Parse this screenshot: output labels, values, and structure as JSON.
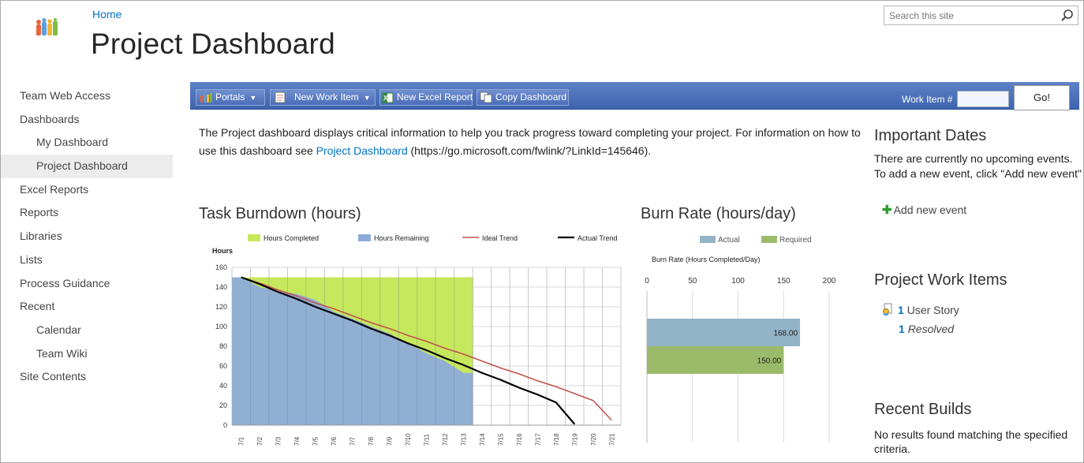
{
  "header": {
    "breadcrumb": "Home",
    "title": "Project Dashboard",
    "search_placeholder": "Search this site"
  },
  "nav": {
    "items": [
      {
        "label": "Team Web Access",
        "level": 0,
        "selected": false
      },
      {
        "label": "Dashboards",
        "level": 0,
        "selected": false
      },
      {
        "label": "My Dashboard",
        "level": 1,
        "selected": false
      },
      {
        "label": "Project Dashboard",
        "level": 1,
        "selected": true
      },
      {
        "label": "Excel Reports",
        "level": 0,
        "selected": false
      },
      {
        "label": "Reports",
        "level": 0,
        "selected": false
      },
      {
        "label": "Libraries",
        "level": 0,
        "selected": false
      },
      {
        "label": "Lists",
        "level": 0,
        "selected": false
      },
      {
        "label": "Process Guidance",
        "level": 0,
        "selected": false
      },
      {
        "label": "Recent",
        "level": 0,
        "selected": false
      },
      {
        "label": "Calendar",
        "level": 1,
        "selected": false
      },
      {
        "label": "Team Wiki",
        "level": 1,
        "selected": false
      },
      {
        "label": "Site Contents",
        "level": 0,
        "selected": false
      }
    ]
  },
  "toolbar": {
    "portals": "Portals",
    "new_work_item": "New Work Item",
    "new_excel_report": "New Excel Report",
    "copy_dashboard": "Copy Dashboard",
    "work_item_label": "Work Item #",
    "go": "Go!"
  },
  "description": {
    "before": "The Project dashboard displays critical information to help you track progress toward completing your project. For information on how to use this dashboard see ",
    "link": "Project Dashboard",
    "after": " (https://go.microsoft.com/fwlink/?LinkId=145646)."
  },
  "burndown": {
    "title": "Task Burndown (hours)"
  },
  "burnrate": {
    "title": "Burn Rate (hours/day)"
  },
  "important_dates": {
    "title": "Important Dates",
    "line1": "There are currently no upcoming events.",
    "line2": "To add a new event, click \"Add new event\"",
    "add_event": "Add new event"
  },
  "work_items": {
    "title": "Project Work Items",
    "count": "1",
    "type": "User Story",
    "resolved_count": "1",
    "resolved_label": "Resolved"
  },
  "recent_builds": {
    "title": "Recent Builds",
    "text": "No results found matching the specified criteria."
  },
  "colors": {
    "hours_completed": "#c5e85c",
    "hours_remaining": "#8eabd9",
    "ideal_trend": "#c0504d",
    "actual_trend": "#000000",
    "actual_bar": "#93b3c6",
    "required_bar": "#9bbb6a",
    "toolbar": "#4a6fb8",
    "link": "#0072c6"
  },
  "chart_data": [
    {
      "type": "area",
      "y_axis_title": "Hours",
      "ylim": [
        0,
        160
      ],
      "y_ticks": [
        0,
        20,
        40,
        60,
        80,
        100,
        120,
        140,
        160
      ],
      "x": [
        "7/1",
        "7/2",
        "7/3",
        "7/4",
        "7/5",
        "7/6",
        "7/7",
        "7/8",
        "7/9",
        "7/10",
        "7/11",
        "7/12",
        "7/13",
        "7/14",
        "7/15",
        "7/16",
        "7/17",
        "7/18",
        "7/19",
        "7/20",
        "7/21"
      ],
      "grid": true,
      "legend_position": "top",
      "series": [
        {
          "name": "Hours Completed",
          "kind": "area",
          "values": [
            150,
            150,
            150,
            150,
            150,
            150,
            150,
            150,
            150,
            150,
            150,
            150,
            150,
            null,
            null,
            null,
            null,
            null,
            null,
            null,
            null
          ]
        },
        {
          "name": "Hours Remaining",
          "kind": "area",
          "values": [
            150,
            140,
            136,
            133,
            127,
            115,
            108,
            100,
            93,
            83,
            73,
            65,
            53,
            null,
            null,
            null,
            null,
            null,
            null,
            null,
            null
          ]
        },
        {
          "name": "Ideal Trend",
          "kind": "line",
          "values": [
            150,
            144,
            137,
            131,
            124,
            118,
            111,
            104,
            98,
            91,
            85,
            78,
            72,
            65,
            58,
            52,
            45,
            39,
            32,
            25,
            5
          ]
        },
        {
          "name": "Actual Trend",
          "kind": "line",
          "values": [
            150,
            143,
            135,
            128,
            120,
            113,
            106,
            98,
            91,
            83,
            76,
            68,
            61,
            53,
            46,
            38,
            31,
            23,
            1,
            null,
            null
          ]
        }
      ]
    },
    {
      "type": "bar",
      "orientation": "horizontal",
      "title": "Burn Rate (Hours Completed/Day)",
      "xlim": [
        0,
        200
      ],
      "x_ticks": [
        0,
        50,
        100,
        150,
        200
      ],
      "legend_position": "top",
      "categories": [
        "Actual",
        "Required"
      ],
      "values": [
        168.0,
        150.0
      ],
      "labels": [
        "168.00",
        "150.00"
      ]
    }
  ]
}
